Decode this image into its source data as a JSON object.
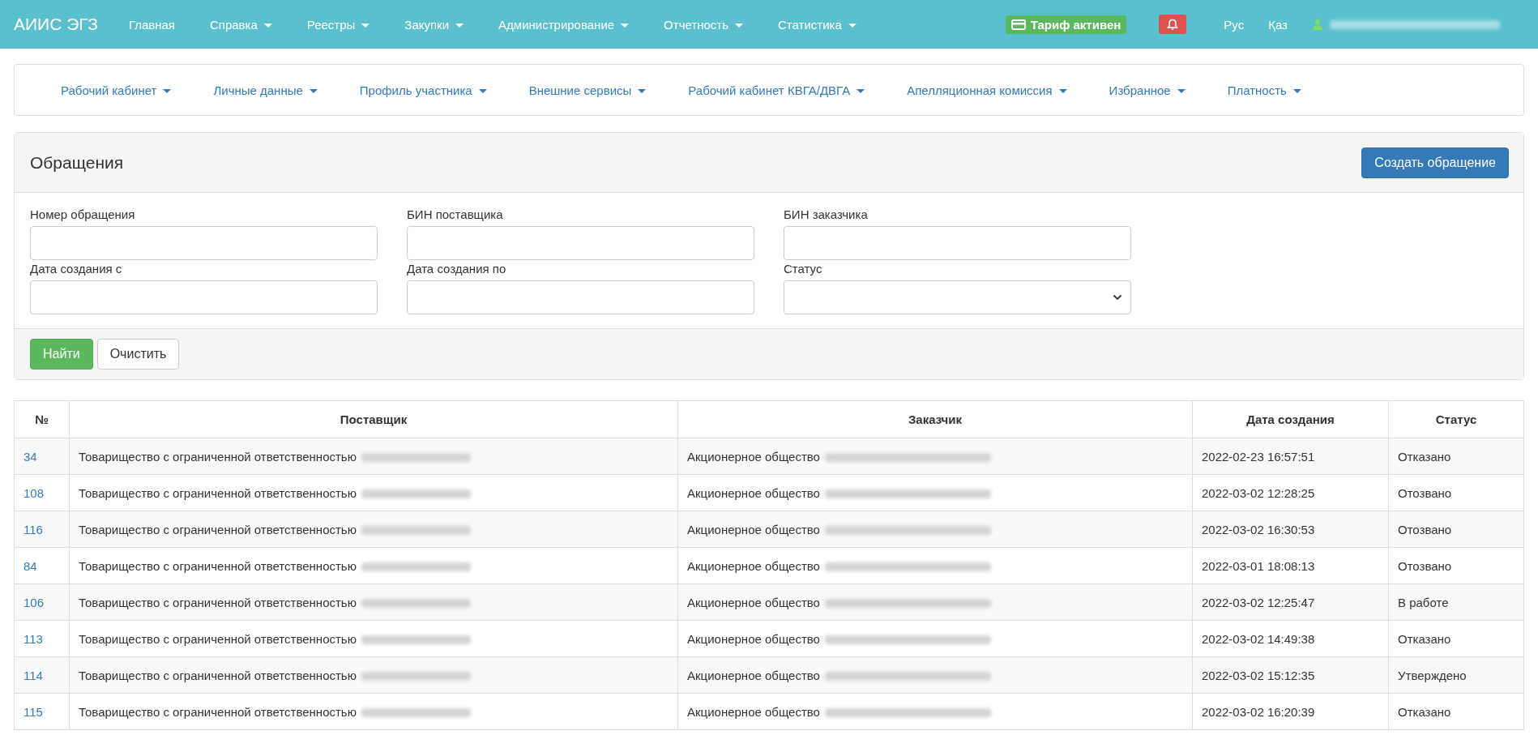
{
  "navbar": {
    "brand": "АИИС ЭГЗ",
    "items": [
      {
        "label": "Главная",
        "dropdown": false
      },
      {
        "label": "Справка",
        "dropdown": true
      },
      {
        "label": "Реестры",
        "dropdown": true
      },
      {
        "label": "Закупки",
        "dropdown": true
      },
      {
        "label": "Администрирование",
        "dropdown": true
      },
      {
        "label": "Отчетность",
        "dropdown": true
      },
      {
        "label": "Статистика",
        "dropdown": true
      }
    ],
    "tariff_badge": "Тариф активен",
    "languages": [
      {
        "label": "Рус"
      },
      {
        "label": "Қаз"
      }
    ]
  },
  "subnav": {
    "items": [
      {
        "label": "Рабочий кабинет"
      },
      {
        "label": "Личные данные"
      },
      {
        "label": "Профиль участника"
      },
      {
        "label": "Внешние сервисы"
      },
      {
        "label": "Рабочий кабинет КВГА/ДВГА"
      },
      {
        "label": "Апелляционная комиссия"
      },
      {
        "label": "Избранное"
      },
      {
        "label": "Платность"
      }
    ]
  },
  "panel": {
    "title": "Обращения",
    "create_button": "Создать обращение",
    "fields": [
      {
        "label": "Номер обращения",
        "kind": "text"
      },
      {
        "label": "БИН поставщика",
        "kind": "text"
      },
      {
        "label": "БИН заказчика",
        "kind": "text"
      },
      {
        "label": "Дата создания с",
        "kind": "text"
      },
      {
        "label": "Дата создания по",
        "kind": "text"
      },
      {
        "label": "Статус",
        "kind": "select"
      }
    ],
    "search_button": "Найти",
    "clear_button": "Очистить"
  },
  "table": {
    "columns": [
      "№",
      "Поставщик",
      "Заказчик",
      "Дата создания",
      "Статус"
    ],
    "rows": [
      {
        "number": "34",
        "supplier": "Товарищество с ограниченной ответственностью",
        "customer": "Акционерное общество",
        "created": "2022-02-23 16:57:51",
        "status": "Отказано"
      },
      {
        "number": "108",
        "supplier": "Товарищество с ограниченной ответственностью",
        "customer": "Акционерное общество",
        "created": "2022-03-02 12:28:25",
        "status": "Отозвано"
      },
      {
        "number": "116",
        "supplier": "Товарищество с ограниченной ответственностью",
        "customer": "Акционерное общество",
        "created": "2022-03-02 16:30:53",
        "status": "Отозвано"
      },
      {
        "number": "84",
        "supplier": "Товарищество с ограниченной ответственностью",
        "customer": "Акционерное общество",
        "created": "2022-03-01 18:08:13",
        "status": "Отозвано"
      },
      {
        "number": "106",
        "supplier": "Товарищество с ограниченной ответственностью",
        "customer": "Акционерное общество",
        "created": "2022-03-02 12:25:47",
        "status": "В работе"
      },
      {
        "number": "113",
        "supplier": "Товарищество с ограниченной ответственностью",
        "customer": "Акционерное общество",
        "created": "2022-03-02 14:49:38",
        "status": "Отказано"
      },
      {
        "number": "114",
        "supplier": "Товарищество с ограниченной ответственностью",
        "customer": "Акционерное общество",
        "created": "2022-03-02 15:12:35",
        "status": "Утверждено"
      },
      {
        "number": "115",
        "supplier": "Товарищество с ограниченной ответственностью",
        "customer": "Акционерное общество",
        "created": "2022-03-02 16:20:39",
        "status": "Отказано"
      }
    ]
  }
}
